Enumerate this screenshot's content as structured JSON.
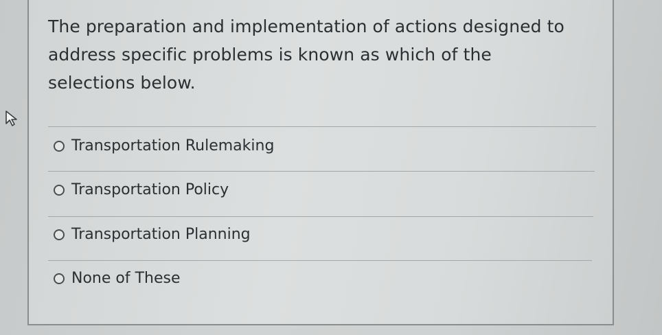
{
  "question": {
    "text": "The preparation and implementation of actions designed to address specific problems is known as which of the selections below."
  },
  "options": [
    {
      "label": "Transportation Rulemaking",
      "selected": false
    },
    {
      "label": "Transportation Policy",
      "selected": false
    },
    {
      "label": "Transportation Planning",
      "selected": false
    },
    {
      "label": "None of These",
      "selected": false
    }
  ],
  "icons": {
    "pointer": "mouse-pointer-icon",
    "radio": "radio-unselected-icon"
  }
}
